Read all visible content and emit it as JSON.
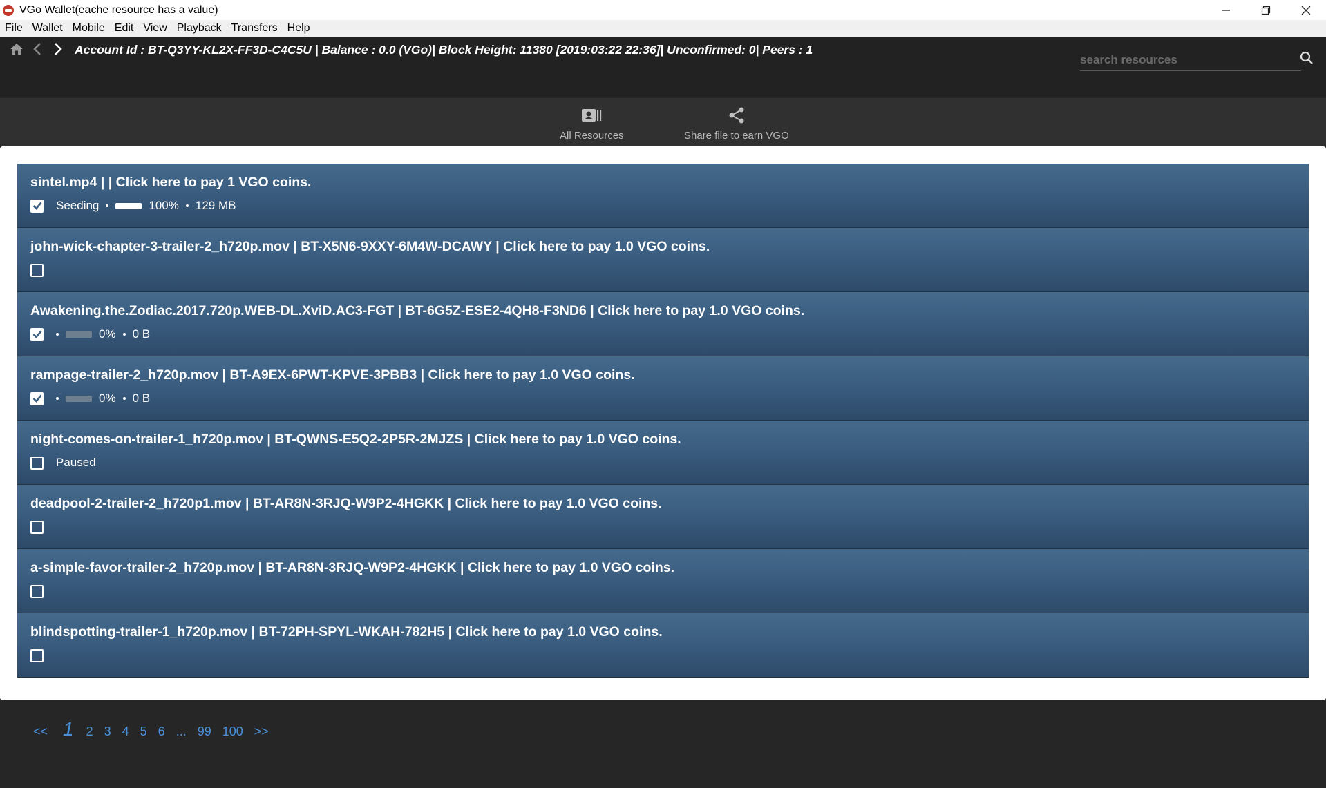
{
  "window": {
    "title": "VGo Wallet(eache resource has a value)",
    "controls": [
      "minimize-icon",
      "restore-icon",
      "close-icon"
    ]
  },
  "menu": [
    "File",
    "Wallet",
    "Mobile",
    "Edit",
    "View",
    "Playback",
    "Transfers",
    "Help"
  ],
  "header": {
    "account_info": "Account Id : BT-Q3YY-KL2X-FF3D-C4C5U | Balance : 0.0 (VGo)| Block Height: 11380 [2019:03:22 22:36]| Unconfirmed: 0| Peers : 1",
    "search_placeholder": "search resources"
  },
  "tabs": [
    {
      "label": "All Resources",
      "icon": "contact-card-icon"
    },
    {
      "label": "Share file to earn VGO",
      "icon": "share-icon"
    }
  ],
  "resources": [
    {
      "title": "sintel.mp4 | | Click here to pay 1 VGO coins.",
      "checked": true,
      "status": "Seeding",
      "progress": 100,
      "progress_text": "100%",
      "size": "129 MB"
    },
    {
      "title": "john-wick-chapter-3-trailer-2_h720p.mov | BT-X5N6-9XXY-6M4W-DCAWY | Click here to pay 1.0 VGO coins.",
      "checked": false,
      "status": "",
      "progress": null,
      "progress_text": "",
      "size": ""
    },
    {
      "title": "Awakening.the.Zodiac.2017.720p.WEB-DL.XviD.AC3-FGT | BT-6G5Z-ESE2-4QH8-F3ND6 | Click here to pay 1.0 VGO coins.",
      "checked": true,
      "status": "",
      "progress": 0,
      "progress_text": "0%",
      "size": "0 B"
    },
    {
      "title": "rampage-trailer-2_h720p.mov | BT-A9EX-6PWT-KPVE-3PBB3 | Click here to pay 1.0 VGO coins.",
      "checked": true,
      "status": "",
      "progress": 0,
      "progress_text": "0%",
      "size": "0 B"
    },
    {
      "title": "night-comes-on-trailer-1_h720p.mov | BT-QWNS-E5Q2-2P5R-2MJZS | Click here to pay 1.0 VGO coins.",
      "checked": false,
      "status": "Paused",
      "progress": null,
      "progress_text": "",
      "size": ""
    },
    {
      "title": "deadpool-2-trailer-2_h720p1.mov | BT-AR8N-3RJQ-W9P2-4HGKK | Click here to pay 1.0 VGO coins.",
      "checked": false,
      "status": "",
      "progress": null,
      "progress_text": "",
      "size": ""
    },
    {
      "title": "a-simple-favor-trailer-2_h720p.mov | BT-AR8N-3RJQ-W9P2-4HGKK | Click here to pay 1.0 VGO coins.",
      "checked": false,
      "status": "",
      "progress": null,
      "progress_text": "",
      "size": ""
    },
    {
      "title": "blindspotting-trailer-1_h720p.mov | BT-72PH-SPYL-WKAH-782H5 | Click here to pay 1.0 VGO coins.",
      "checked": false,
      "status": "",
      "progress": null,
      "progress_text": "",
      "size": ""
    }
  ],
  "pagination": {
    "prev": "<<",
    "current": "1",
    "pages": [
      "2",
      "3",
      "4",
      "5",
      "6",
      "...",
      "99",
      "100"
    ],
    "next": ">>"
  },
  "colors": {
    "accent": "#4a90d9",
    "row_bg": "#3a5d80",
    "header_bg": "#222222"
  }
}
